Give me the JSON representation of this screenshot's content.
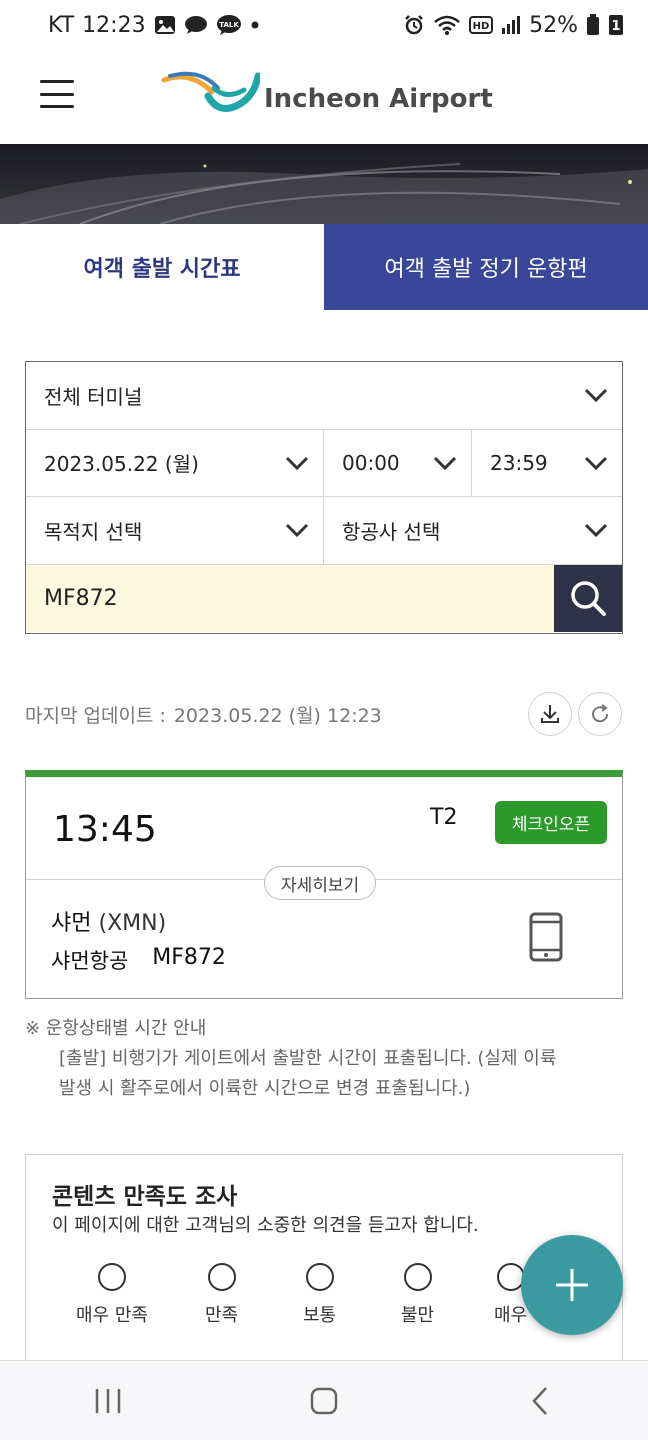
{
  "status_bar": {
    "carrier": "KT",
    "time": "12:23",
    "battery": "52%",
    "hd_label": "HD",
    "talk_label": "TALK",
    "sim_badge": "1"
  },
  "header": {
    "logo_text": "Incheon Airport"
  },
  "tabs": [
    {
      "label": "여객 출발 시간표",
      "active": true
    },
    {
      "label": "여객 출발 정기 운항편",
      "active": false
    }
  ],
  "form": {
    "terminal": "전체 터미널",
    "date": "2023.05.22 (월)",
    "time_from": "00:00",
    "time_to": "23:59",
    "destination": "목적지 선택",
    "airline": "항공사 선택",
    "search_value": "MF872"
  },
  "update": {
    "label": "마지막 업데이트 :",
    "value": "2023.05.22 (월) 12:23"
  },
  "flight": {
    "time": "13:45",
    "terminal": "T2",
    "status": "체크인오픈",
    "detail_label": "자세히보기",
    "destination": "샤먼",
    "destination_code": "(XMN)",
    "airline": "샤먼항공",
    "flight_no": "MF872",
    "status_color": "#2b9a2b"
  },
  "notes": {
    "title": "※ 운항상태별 시간 안내",
    "line1": "[출발] 비행기가 게이트에서 출발한 시간이 표출됩니다. (실제 이륙",
    "line2": "발생 시 활주로에서 이륙한 시간으로 변경 표출됩니다.)"
  },
  "survey": {
    "title": "콘텐츠 만족도 조사",
    "description": "이 페이지에 대한 고객님의 소중한 의견을 듣고자 합니다.",
    "options": [
      "매우 만족",
      "만족",
      "보통",
      "불만",
      "매우"
    ]
  },
  "colors": {
    "tab_active_text": "#2c3a7d",
    "tab_inactive_bg": "#3a4798",
    "search_btn": "#2e3246",
    "fab": "#3a9aa0"
  }
}
